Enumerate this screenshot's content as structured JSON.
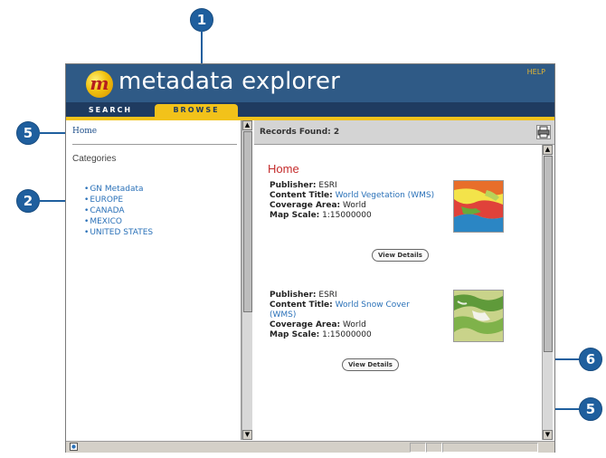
{
  "app": {
    "title": "metadata explorer",
    "logo_letter": "m",
    "help_label": "HELP"
  },
  "tabs": [
    {
      "label": "SEARCH",
      "active": false
    },
    {
      "label": "BROWSE",
      "active": true
    }
  ],
  "left_panel": {
    "home_link": "Home",
    "categories_label": "Categories",
    "categories": [
      "GN Metadata",
      "EUROPE",
      "CANADA",
      "MEXICO",
      "UNITED STATES"
    ]
  },
  "results": {
    "records_found": "Records Found: 2",
    "section_title": "Home",
    "records": [
      {
        "publisher_label": "Publisher:",
        "publisher": "ESRI",
        "content_title_label": "Content Title:",
        "content_title": "World Vegetation (WMS)",
        "coverage_area_label": "Coverage Area:",
        "coverage_area": "World",
        "map_scale_label": "Map Scale:",
        "map_scale": "1:15000000",
        "view_details": "View Details"
      },
      {
        "publisher_label": "Publisher:",
        "publisher": "ESRI",
        "content_title_label": "Content Title:",
        "content_title": "World Snow Cover (WMS)",
        "coverage_area_label": "Coverage Area:",
        "coverage_area": "World",
        "map_scale_label": "Map Scale:",
        "map_scale": "1:15000000",
        "view_details": "View Details"
      }
    ]
  },
  "callouts": [
    "1",
    "2",
    "5",
    "6",
    "5"
  ],
  "colors": {
    "header_bg": "#2f5a86",
    "tab_bar_bg": "#1f3b60",
    "accent_gold": "#f2c21a",
    "link_blue": "#2a71b8",
    "title_red": "#c42b2b",
    "callout_blue": "#1f5f9e"
  },
  "icons": [
    "logo-ball-icon",
    "printer-icon",
    "scroll-up-icon",
    "scroll-down-icon",
    "ie-page-icon"
  ]
}
